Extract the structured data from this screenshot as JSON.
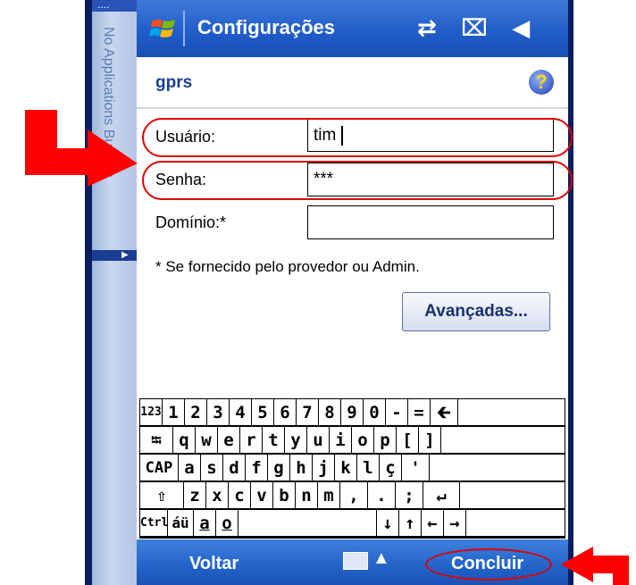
{
  "sidebar": {
    "dots": "....",
    "label": "No Applications Buttons",
    "arrow": "▶"
  },
  "titlebar": {
    "title": "Configurações",
    "status_icons": "⇄ ⌧ ◀"
  },
  "subheader": {
    "title": "gprs",
    "help": "?"
  },
  "form": {
    "user_label": "Usuário:",
    "user_value": "tim",
    "password_label": "Senha:",
    "password_value": "***",
    "domain_label": "Domínio:*",
    "domain_value": "",
    "note": "* Se fornecido pelo provedor ou Admin.",
    "advanced_button": "Avançadas..."
  },
  "keyboard": {
    "rows": [
      [
        "123",
        "1",
        "2",
        "3",
        "4",
        "5",
        "6",
        "7",
        "8",
        "9",
        "0",
        "-",
        "=",
        "🡰"
      ],
      [
        "⭾",
        "q",
        "w",
        "e",
        "r",
        "t",
        "y",
        "u",
        "i",
        "o",
        "p",
        "[",
        "]"
      ],
      [
        "CAP",
        "a",
        "s",
        "d",
        "f",
        "g",
        "h",
        "j",
        "k",
        "l",
        "ç",
        "'"
      ],
      [
        "⇧",
        "z",
        "x",
        "c",
        "v",
        "b",
        "n",
        "m",
        ",",
        ".",
        ";",
        "↵"
      ],
      [
        "Ctrl",
        "áü",
        "a",
        "o",
        "",
        "↓",
        "↑",
        "←",
        "→"
      ]
    ]
  },
  "bottombar": {
    "left": "Voltar",
    "right": "Concluir"
  },
  "colors": {
    "highlight": "#e00000",
    "titlebar": "#1f5bc7",
    "arrow": "#ff0000"
  }
}
